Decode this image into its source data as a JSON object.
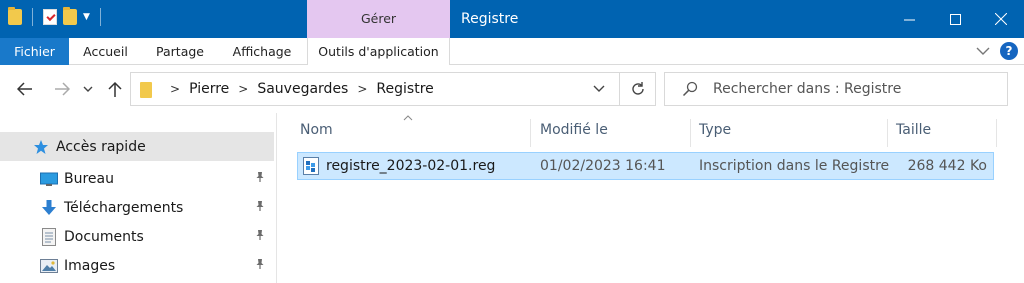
{
  "window": {
    "title": "Registre",
    "context_tab": "Gérer"
  },
  "ribbon": {
    "tabs": [
      "Fichier",
      "Accueil",
      "Partage",
      "Affichage",
      "Outils d'application"
    ]
  },
  "address": {
    "crumbs": [
      "Pierre",
      "Sauvegardes",
      "Registre"
    ]
  },
  "search": {
    "placeholder": "Rechercher dans : Registre"
  },
  "sidebar": {
    "items": [
      {
        "label": "Accès rapide",
        "icon": "star-icon"
      },
      {
        "label": "Bureau",
        "icon": "desktop-icon"
      },
      {
        "label": "Téléchargements",
        "icon": "download-icon"
      },
      {
        "label": "Documents",
        "icon": "documents-icon"
      },
      {
        "label": "Images",
        "icon": "images-icon"
      }
    ]
  },
  "table": {
    "columns": [
      "Nom",
      "Modifié le",
      "Type",
      "Taille"
    ],
    "rows": [
      {
        "name": "registre_2023-02-01.reg",
        "modified": "01/02/2023 16:41",
        "type": "Inscription dans le Registre",
        "size": "268 442 Ko"
      }
    ]
  },
  "colors": {
    "titlebar": "#0063b1",
    "context_tab": "#e4c7f0",
    "file_tab": "#1979ca",
    "selection": "#cce8ff"
  }
}
